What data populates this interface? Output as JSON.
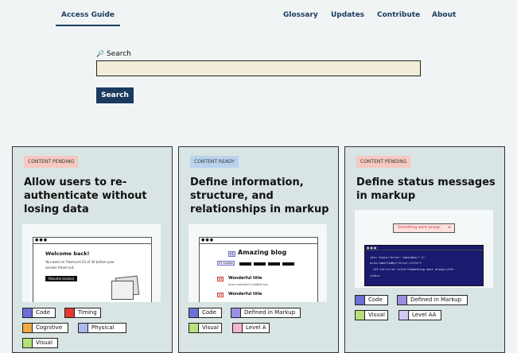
{
  "nav": {
    "brand": "Access Guide",
    "links": [
      "Glossary",
      "Updates",
      "Contribute",
      "About"
    ]
  },
  "search": {
    "label": "Search",
    "button": "Search",
    "value": ""
  },
  "cards": [
    {
      "badge": "CONTENT PENDING",
      "title": "Allow users to re-authenticate without losing data",
      "illus": {
        "heading": "Welcome back!",
        "line1": "You were on Flashcard 23 of 30 before your",
        "line2": "session timed out.",
        "button": "Resume session"
      },
      "tags": [
        "Code",
        "Timing",
        "Cognitive",
        "Physical",
        "Visual"
      ]
    },
    {
      "badge": "CONTENT READY",
      "title": "Define information, structure, and relationships in markup",
      "illus": {
        "h1_tag": "h1",
        "heading": "Amazing blog",
        "caption": "h2 explain",
        "h2_tag": "h2",
        "item1": "Wonderful title",
        "item1_sub": "And a wonderful subtitle too",
        "item2": "Wonderful title"
      },
      "tags": [
        "Code",
        "Defined in Markup",
        "Visual",
        "Level A"
      ]
    },
    {
      "badge": "CONTENT PENDING",
      "title": "Define status messages in markup",
      "illus": {
        "alert": "Something went wrong!",
        "alert_close": "×",
        "code1": "<div class=\"error\" tabindex=\"-1\"",
        "code2": "aria-labelledby=\"error-title\">",
        "code3": "<h3 id=\"error-title\">Something went wrong!</h3>",
        "code4": "</div>"
      },
      "tags": [
        "Code",
        "Defined in Markup",
        "Visual",
        "Level AA"
      ]
    }
  ],
  "colors": {
    "nav": "#1a3a5f",
    "pending": "#f6c9c0",
    "ready": "#b9d3ef",
    "code_tag": "#6b6fd6",
    "timing_tag": "#e03a32",
    "cognitive_tag": "#f0a844",
    "physical_tag": "#b0b6f0",
    "visual_tag": "#b6e07a",
    "markup_tag": "#9a8ee0",
    "levelA_tag": "#f3b3d4",
    "levelAA_tag": "#d4c9f4"
  }
}
